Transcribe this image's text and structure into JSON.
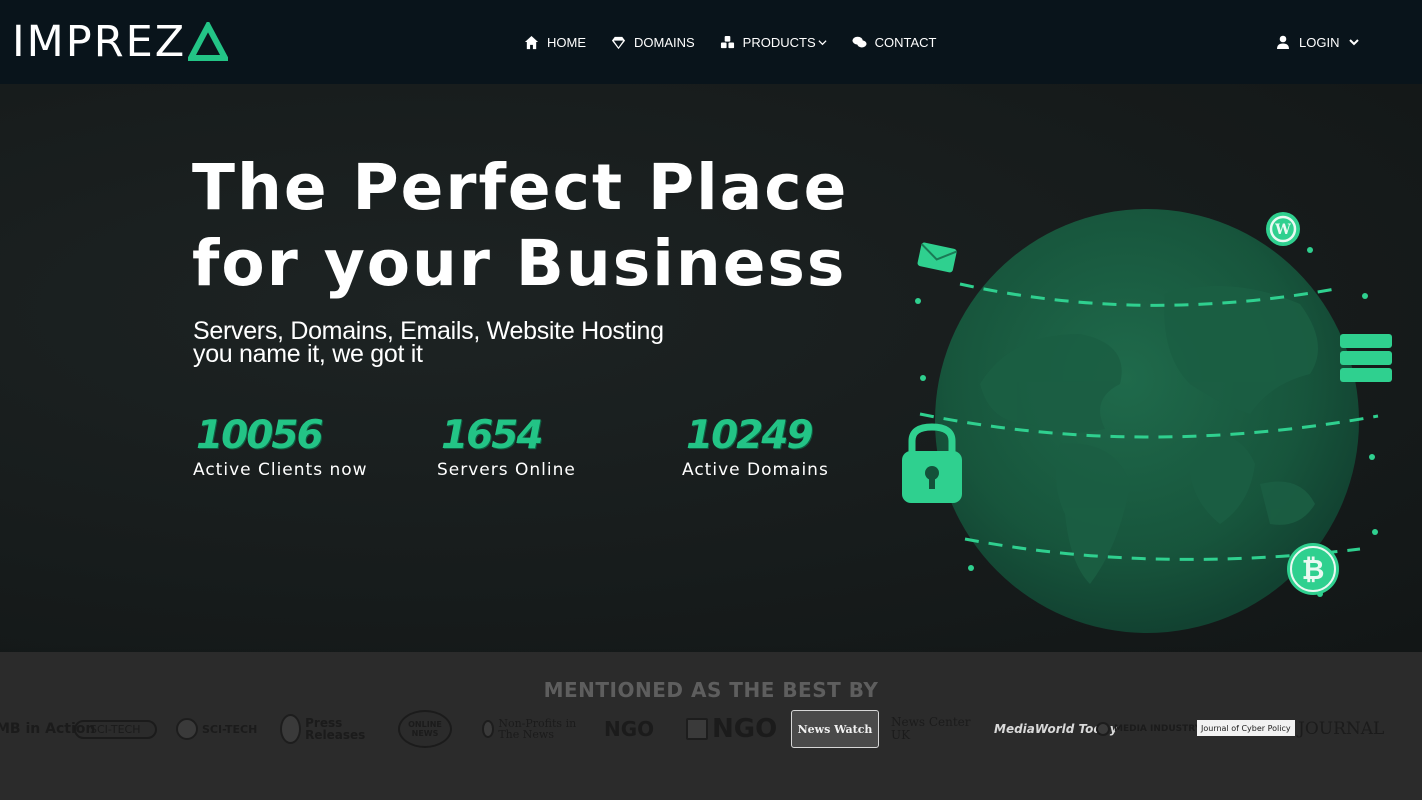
{
  "brand": {
    "name": "IMPREZ",
    "accent_color": "#23c486"
  },
  "nav": {
    "items": [
      {
        "label": "HOME",
        "icon": "home-icon"
      },
      {
        "label": "DOMAINS",
        "icon": "diamond-icon"
      },
      {
        "label": "PRODUCTS",
        "icon": "cubes-icon"
      },
      {
        "label": "CONTACT",
        "icon": "chat-icon"
      }
    ],
    "login_label": "LOGIN"
  },
  "hero": {
    "title_line1": "The Perfect Place",
    "title_line2": "for your Business",
    "sub_line1": "Servers, Domains, Emails, Website Hosting",
    "sub_line2": "you name it, we got it",
    "stats": [
      {
        "value": "10056",
        "label": "Active Clients now"
      },
      {
        "value": "1654",
        "label": "Servers Online"
      },
      {
        "value": "10249",
        "label": "Active Domains"
      }
    ]
  },
  "mentioned": {
    "title": "MENTIONED AS THE BEST BY",
    "publications": [
      {
        "name": "MB in Action"
      },
      {
        "name": "SCI-TECH"
      },
      {
        "name": "SCI-TECH"
      },
      {
        "name": "Press Releases"
      },
      {
        "name": "ONLINE NEWS"
      },
      {
        "name": "Non-Profits in The News"
      },
      {
        "name": "NGO"
      },
      {
        "name": "NGO"
      },
      {
        "name": "News Watch"
      },
      {
        "name": "News Center UK"
      },
      {
        "name": "MediaWorld Today"
      },
      {
        "name": "MEDIA INDUSTRY"
      },
      {
        "name": "Journal of Cyber Policy"
      },
      {
        "name": "JOURNAL"
      }
    ]
  }
}
